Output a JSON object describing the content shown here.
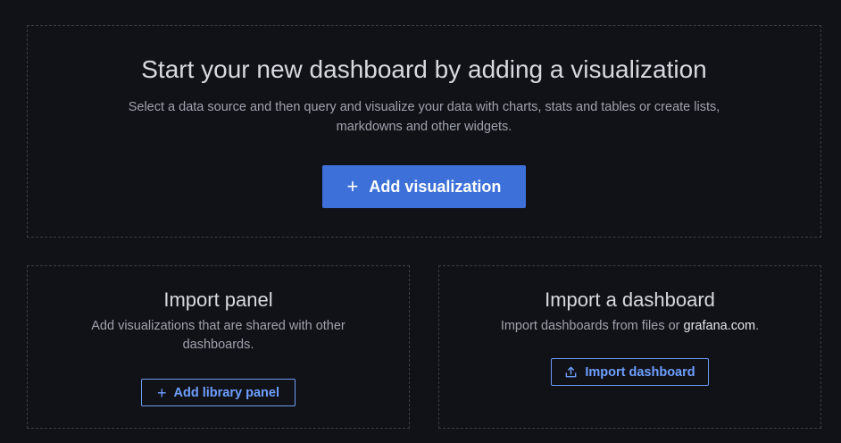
{
  "hero": {
    "title": "Start your new dashboard by adding a visualization",
    "description": "Select a data source and then query and visualize your data with charts, stats and tables or create lists, markdowns and other widgets.",
    "button_label": "Add visualization",
    "button_icon": "plus-icon"
  },
  "import_panel": {
    "title": "Import panel",
    "description": "Add visualizations that are shared with other dashboards.",
    "button_label": "Add library panel",
    "button_icon": "plus-icon"
  },
  "import_dashboard": {
    "title": "Import a dashboard",
    "description_prefix": "Import dashboards from files or ",
    "description_link": "grafana.com",
    "description_suffix": ".",
    "button_label": "Import dashboard",
    "button_icon": "upload-icon"
  },
  "colors": {
    "background": "#111217",
    "primary": "#3d71d9",
    "link_blue": "#6e9fff",
    "dashed_border": "#3a3d47"
  }
}
